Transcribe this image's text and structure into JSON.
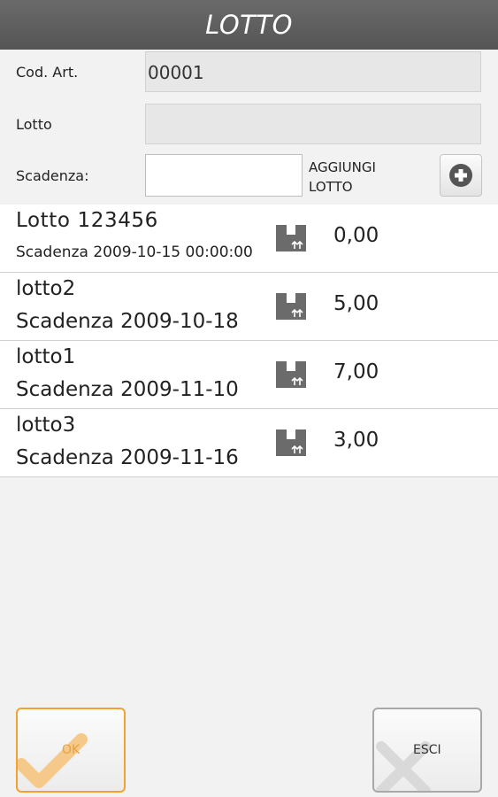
{
  "header": {
    "title": "LOTTO"
  },
  "form": {
    "cod_art_label": "Cod. Art.",
    "cod_art_value": "00001",
    "lotto_label": "Lotto",
    "lotto_value": "",
    "scadenza_label": "Scadenza:",
    "scadenza_value": "",
    "add_label_line1": "AGGIUNGI",
    "add_label_line2": "LOTTO",
    "add_icon": "plus-circle-icon"
  },
  "lots": [
    {
      "name": "Lotto 123456",
      "expiry": "Scadenza 2009-10-15 00:00:00",
      "qty": "0,00",
      "icon": "box-icon"
    },
    {
      "name": "lotto2",
      "expiry": "Scadenza 2009-10-18",
      "qty": "5,00",
      "icon": "box-icon"
    },
    {
      "name": "lotto1",
      "expiry": "Scadenza 2009-11-10",
      "qty": "7,00",
      "icon": "box-icon"
    },
    {
      "name": "lotto3",
      "expiry": "Scadenza 2009-11-16",
      "qty": "3,00",
      "icon": "box-icon"
    }
  ],
  "footer": {
    "ok_label": "OK",
    "ok_icon": "checkmark-icon",
    "esci_label": "ESCI",
    "esci_icon": "x-icon"
  },
  "colors": {
    "title_bar": "#5f5f5f",
    "ok_accent": "#f2a230",
    "icon_gray": "#6b6b6b"
  }
}
